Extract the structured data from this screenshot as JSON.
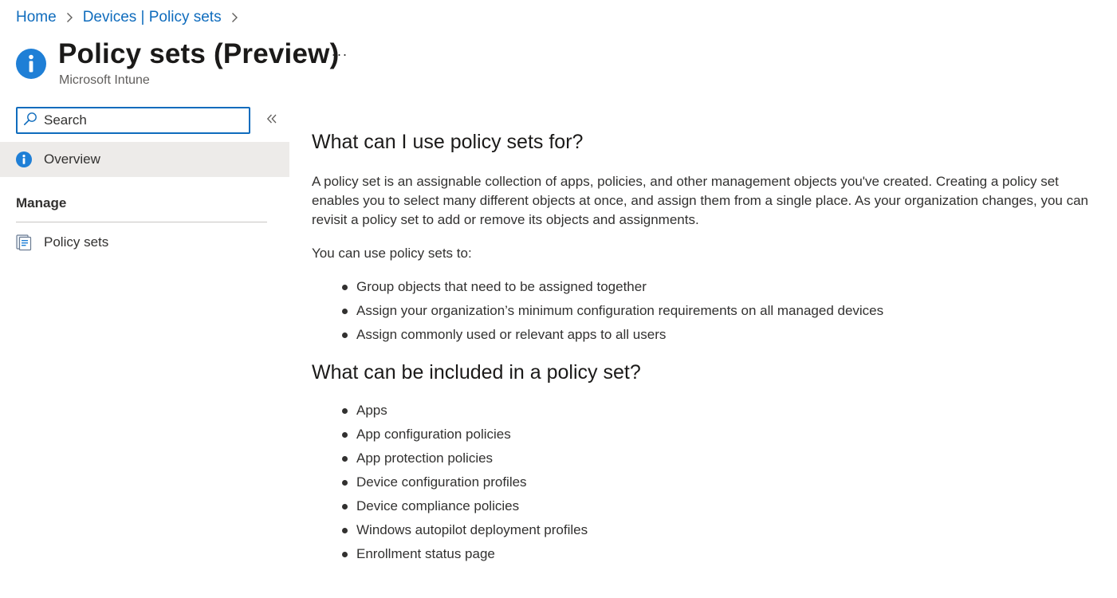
{
  "breadcrumb": {
    "items": [
      "Home",
      "Devices | Policy sets"
    ]
  },
  "header": {
    "title": "Policy sets (Preview)",
    "subtitle": "Microsoft Intune",
    "more_label": "···",
    "icon": "info-icon"
  },
  "sidebar": {
    "search": {
      "placeholder": "Search",
      "value": ""
    },
    "collapse_icon": "chevron-double-left-icon",
    "overview_label": "Overview",
    "section_manage": "Manage",
    "policy_sets_label": "Policy sets"
  },
  "main": {
    "heading_1": "What can I use policy sets for?",
    "intro": "A policy set is an assignable collection of apps, policies, and other management objects you've created. Creating a policy set enables you to select many different objects at once, and assign them from a single place. As your organization changes, you can revisit a policy set to add or remove its objects and assignments.",
    "lead": "You can use policy sets to:",
    "uses": [
      "Group objects that need to be assigned together",
      "Assign your organization’s minimum configuration requirements on all managed devices",
      "Assign commonly used or relevant apps to all users"
    ],
    "heading_2": "What can be included in a policy set?",
    "included": [
      "Apps",
      "App configuration policies",
      "App protection policies",
      "Device configuration profiles",
      "Device compliance policies",
      "Windows autopilot deployment profiles",
      "Enrollment status page"
    ]
  },
  "colors": {
    "accent": "#0f6cbd",
    "selected_nav": "#edebe9",
    "text": "#323130"
  }
}
